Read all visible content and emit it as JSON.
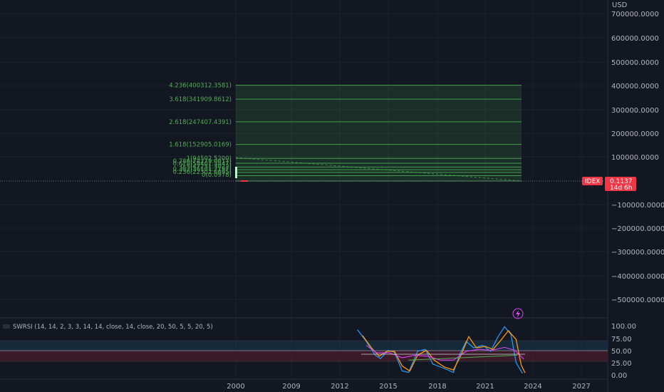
{
  "currency_label": "USD",
  "price_axis": {
    "ticks": [
      "700000.0000",
      "600000.0000",
      "500000.0000",
      "400000.0000",
      "300000.0000",
      "200000.0000",
      "100000.0000",
      "−100000.0000",
      "−200000.0000",
      "−300000.0000",
      "−400000.0000",
      "−500000.0000"
    ]
  },
  "time_axis": {
    "ticks": [
      "2000",
      "2009",
      "2012",
      "2015",
      "2018",
      "2021",
      "2024",
      "2027"
    ]
  },
  "symbol_badge": {
    "symbol": "IDEX",
    "price": "0.1137",
    "countdown": "14d 6h",
    "color": "#f23645"
  },
  "fib_levels": [
    {
      "label": "4.236(400312.3581)",
      "value": 400312.3581
    },
    {
      "label": "3.618(341909.8612)",
      "value": 341909.8612
    },
    {
      "label": "2.618(247407.4391)",
      "value": 247407.4391
    },
    {
      "label": "1.618(152905.0169)",
      "value": 152905.0169
    },
    {
      "label": "1(94502.5200)",
      "value": 94502.52
    },
    {
      "label": "0.786(74279.0017)",
      "value": 74279.0017
    },
    {
      "label": "0.618(58401.3847)",
      "value": 58401.3847
    },
    {
      "label": "0.5(47251.3022)",
      "value": 47251.3022
    },
    {
      "label": "0.382(36101.2197)",
      "value": 36101.2197
    },
    {
      "label": "0.236(22302.6695)",
      "value": 22302.6695
    },
    {
      "label": "0(0.0978)",
      "value": 0.0978
    }
  ],
  "indicator": {
    "title": "SWRSI (14, 14, 2, 3, 3, 14, 14, close, 14, close, 20, 50, 5, 5, 20, 5)",
    "ticks": [
      "100.00",
      "75.00",
      "50.00",
      "25.00",
      "0.00"
    ],
    "icon": "lightning-icon"
  },
  "colors": {
    "background": "#131722",
    "fib": "#4caf50",
    "accent_red": "#f23645",
    "indicator_blue": "#2196f3",
    "indicator_orange": "#ff9800",
    "indicator_pink": "#e040fb",
    "indicator_light": "#d1d4dc"
  },
  "chart_data": {
    "type": "line",
    "title": "",
    "series": [
      {
        "values": [
          [
            2009.5,
            92
          ],
          [
            2010.2,
            68
          ],
          [
            2010.9,
            40
          ],
          [
            2011.3,
            33
          ],
          [
            2011.9,
            50
          ],
          [
            2012.4,
            46
          ],
          [
            2013.0,
            8
          ],
          [
            2013.5,
            5
          ],
          [
            2014.2,
            48
          ],
          [
            2014.8,
            52
          ],
          [
            2015.4,
            22
          ],
          [
            2016.2,
            14
          ],
          [
            2017.0,
            5
          ],
          [
            2017.5,
            42
          ],
          [
            2018.0,
            68
          ],
          [
            2018.6,
            55
          ],
          [
            2019.3,
            60
          ],
          [
            2019.9,
            48
          ],
          [
            2020.5,
            78
          ],
          [
            2021.0,
            98
          ],
          [
            2021.5,
            82
          ],
          [
            2021.9,
            25
          ],
          [
            2022.4,
            3
          ]
        ]
      },
      {
        "values": [
          [
            2009.9,
            80
          ],
          [
            2010.6,
            55
          ],
          [
            2011.2,
            38
          ],
          [
            2011.8,
            48
          ],
          [
            2012.4,
            48
          ],
          [
            2013.0,
            18
          ],
          [
            2013.6,
            8
          ],
          [
            2014.2,
            40
          ],
          [
            2014.9,
            50
          ],
          [
            2015.5,
            30
          ],
          [
            2016.3,
            16
          ],
          [
            2017.0,
            10
          ],
          [
            2017.6,
            40
          ],
          [
            2018.2,
            78
          ],
          [
            2018.8,
            55
          ],
          [
            2019.5,
            58
          ],
          [
            2020.1,
            52
          ],
          [
            2020.7,
            70
          ],
          [
            2021.3,
            90
          ],
          [
            2021.9,
            72
          ],
          [
            2022.3,
            20
          ],
          [
            2022.6,
            4
          ]
        ]
      },
      {
        "values": [
          [
            2010.2,
            60
          ],
          [
            2011.0,
            45
          ],
          [
            2012.0,
            45
          ],
          [
            2013.0,
            35
          ],
          [
            2014.0,
            40
          ],
          [
            2015.0,
            38
          ],
          [
            2016.0,
            30
          ],
          [
            2017.0,
            30
          ],
          [
            2018.0,
            48
          ],
          [
            2019.0,
            52
          ],
          [
            2020.0,
            50
          ],
          [
            2021.0,
            56
          ],
          [
            2021.8,
            50
          ],
          [
            2022.5,
            32
          ]
        ]
      },
      {
        "values": [
          [
            2009.8,
            42
          ],
          [
            2022.6,
            42
          ]
        ]
      },
      {
        "values": [
          [
            2013.5,
            30
          ],
          [
            2022.0,
            40
          ]
        ]
      }
    ],
    "ylim": [
      0,
      100
    ],
    "xlim": [
      1998.3,
      2028.6
    ],
    "grid": true
  }
}
